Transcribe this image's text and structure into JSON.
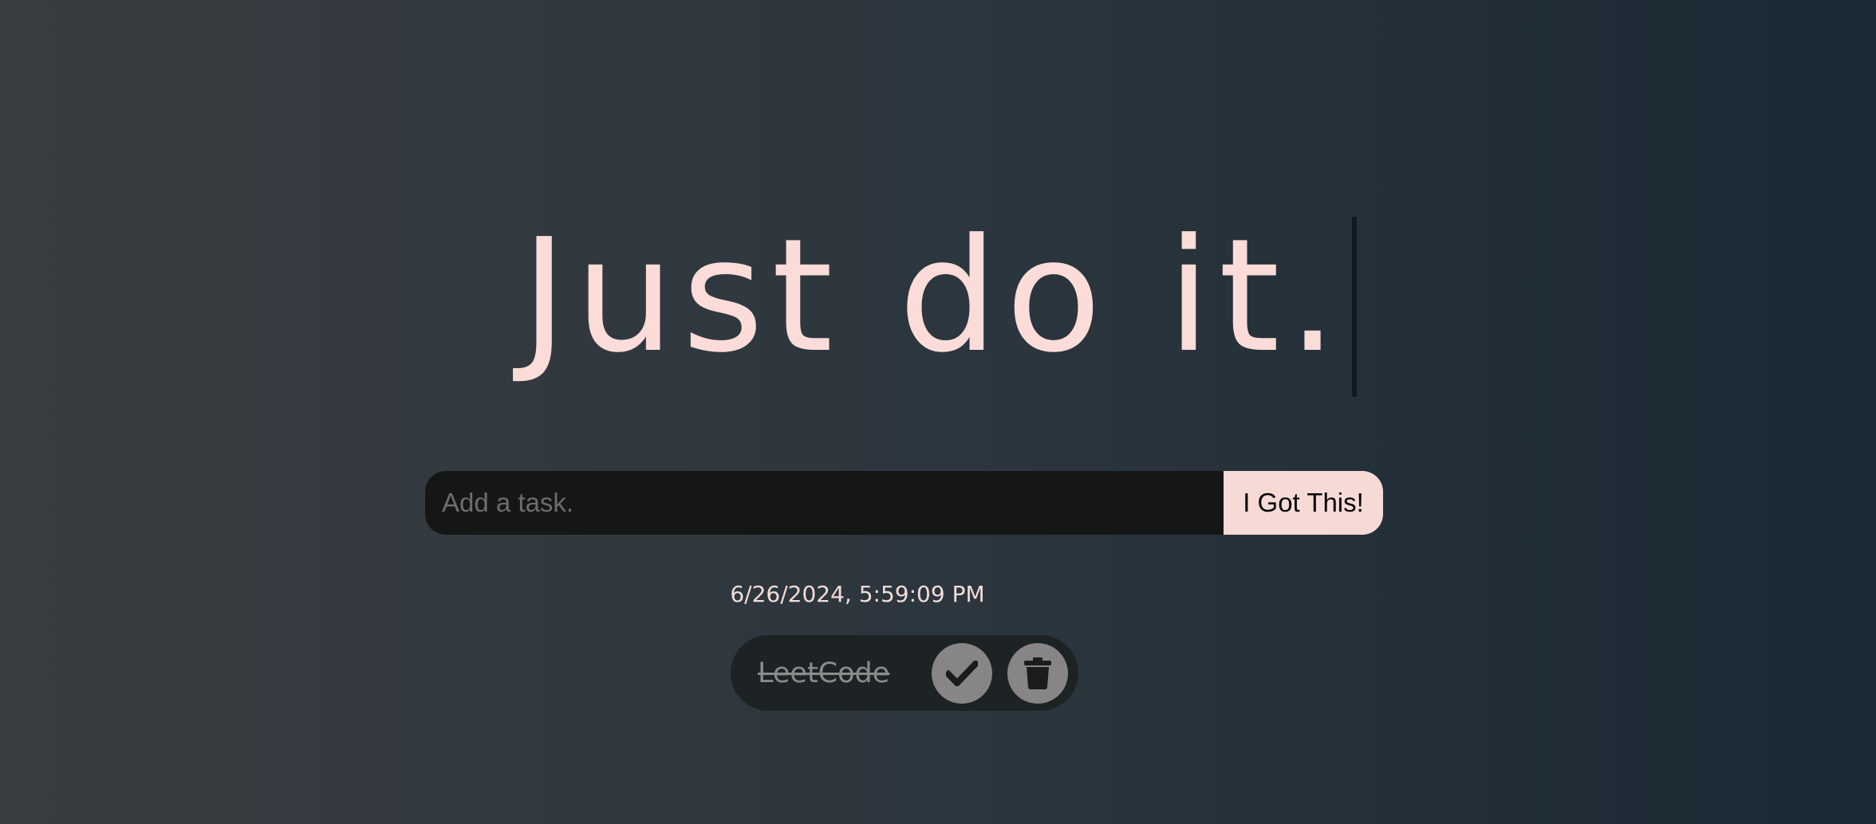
{
  "header": {
    "title": "Just do it."
  },
  "task_form": {
    "input_placeholder": "Add a task.",
    "input_value": "",
    "submit_label": "I Got This!"
  },
  "datetime": "6/26/2024, 5:59:09 PM",
  "todos": [
    {
      "text": "LeetCode",
      "completed": true,
      "complete_icon": "check-icon",
      "delete_icon": "trash-icon"
    }
  ],
  "colors": {
    "accent_pink": "#fcdcd8",
    "button_bg": "#f6dad6",
    "input_bg": "#151717",
    "todo_bg": "#1d2224",
    "icon_button_bg": "#878586",
    "icon_color": "#1a1c1e"
  }
}
